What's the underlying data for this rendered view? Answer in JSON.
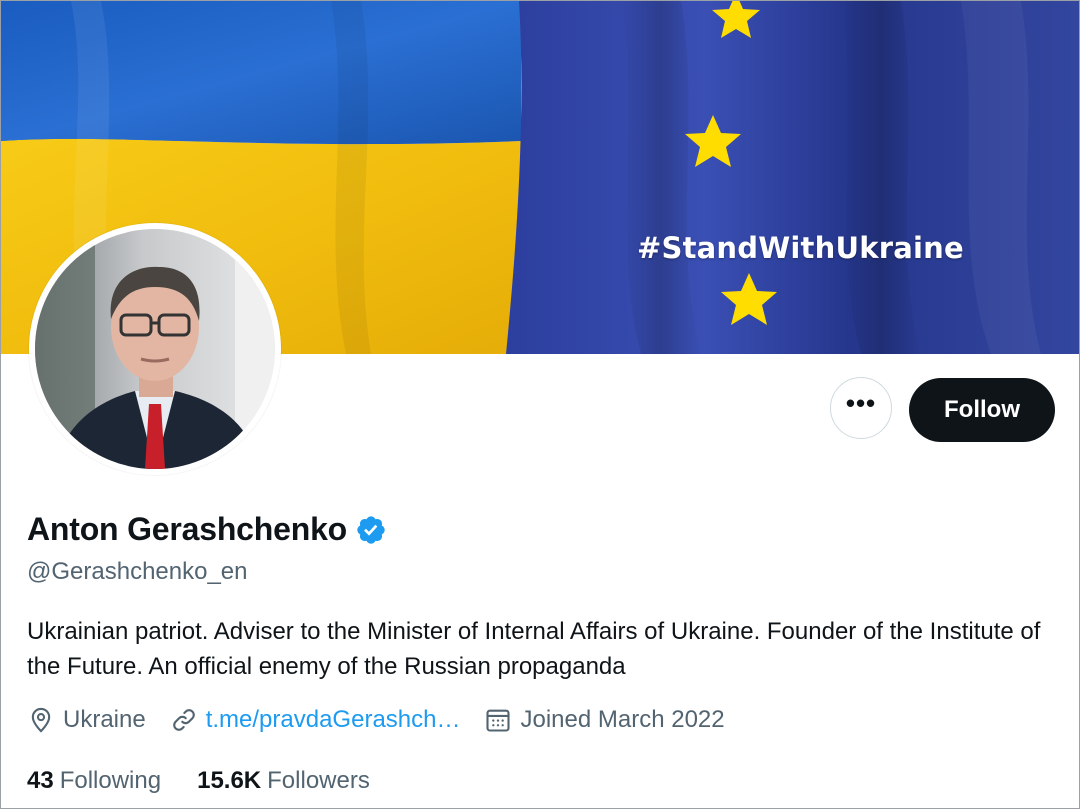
{
  "banner": {
    "hashtag": "#StandWithUkraine",
    "flag_colors": {
      "ukraine_blue": "#1f63c6",
      "ukraine_yellow": "#f4c414",
      "eu_blue": "#2a3f9c",
      "eu_star": "#ffdd00"
    }
  },
  "profile": {
    "display_name": "Anton Gerashchenko",
    "verified": true,
    "handle": "@Gerashchenko_en",
    "bio": "Ukrainian patriot. Adviser to the Minister of Internal Affairs of Ukraine. Founder of the Institute of the Future. An official enemy of the Russian propaganda",
    "location": "Ukraine",
    "website": "t.me/pravdaGerashch…",
    "joined": "Joined March 2022",
    "stats": {
      "following_count": "43",
      "following_label": "Following",
      "followers_count": "15.6K",
      "followers_label": "Followers"
    }
  },
  "actions": {
    "more_label": "•••",
    "follow_label": "Follow"
  },
  "icons": {
    "verified": "verified-badge-icon",
    "location": "location-pin-icon",
    "link": "link-icon",
    "calendar": "calendar-icon",
    "more": "more-options-icon"
  },
  "colors": {
    "accent_blue": "#1d9bf0",
    "text_primary": "#0f1419",
    "text_secondary": "#536471",
    "follow_bg": "#0f1419"
  }
}
